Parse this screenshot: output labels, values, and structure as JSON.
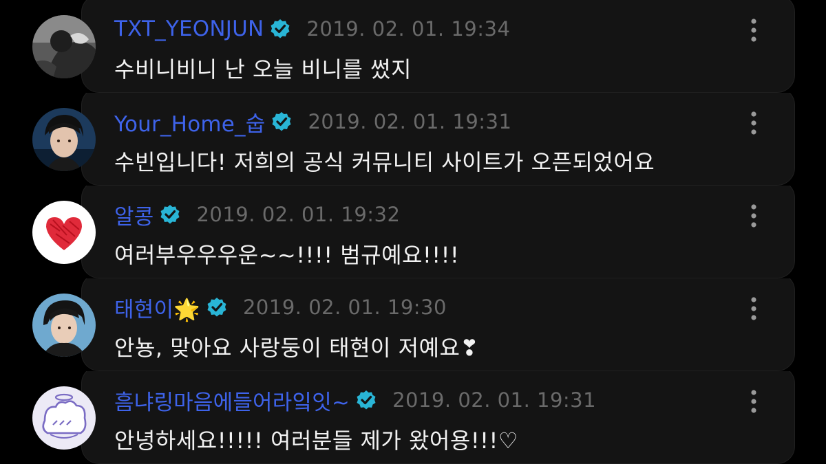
{
  "colors": {
    "background": "#000000",
    "card": "#141414",
    "username": "#3e63ea",
    "verified_badge": "#29b5d6",
    "timestamp": "#6a6a6a",
    "message": "#f2f2f2",
    "more_dots": "#9a9a9a"
  },
  "icons": {
    "verified": "verified-badge-icon",
    "more": "vertical-dots-icon"
  },
  "posts": [
    {
      "username": "TXT_YEONJUN",
      "timestamp": "2019. 02. 01. 19:34",
      "message": "수비니비니 난 오늘 비니를 썼지",
      "avatar": "photo-avatar"
    },
    {
      "username": "Your_Home_숩",
      "timestamp": "2019. 02. 01. 19:31",
      "message": "수빈입니다! 저희의 공식 커뮤니티 사이트가 오픈되었어요",
      "avatar": "photo-avatar"
    },
    {
      "username": "알콩",
      "timestamp": "2019. 02. 01. 19:32",
      "message": "여러부우우우운~~!!!!  범규예요!!!!",
      "avatar": "red-heart-drawing-avatar"
    },
    {
      "username": "태현이🌟",
      "timestamp": "2019. 02. 01. 19:30",
      "message": "안뇽, 맞아요 사랑둥이 태현이 저예요❣",
      "avatar": "photo-avatar"
    },
    {
      "username": "흠냐링마음에들어라잌잇~",
      "timestamp": "2019. 02. 01. 19:31",
      "message": "안녕하세요!!!!! 여러분들 제가 왔어용!!!♡",
      "avatar": "bread-character-drawing-avatar"
    }
  ]
}
